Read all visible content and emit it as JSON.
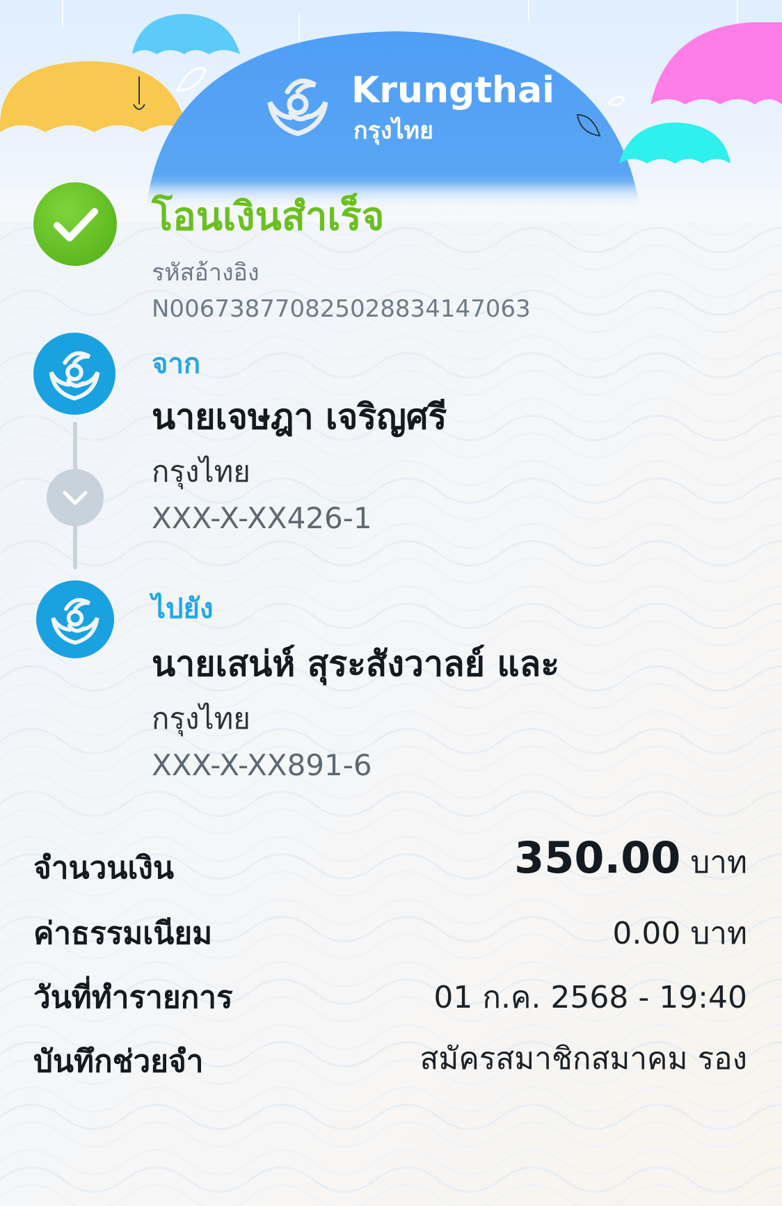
{
  "header": {
    "brand_name": "Krungthai",
    "brand_name_thai": "กรุงไทย"
  },
  "status": {
    "title": "โอนเงินสำเร็จ",
    "reference_label": "รหัสอ้างอิง",
    "reference_value": "N006738770825028834147063"
  },
  "from": {
    "label": "จาก",
    "name": "นายเจษฎา เจริญศรี",
    "bank": "กรุงไทย",
    "account": "XXX-X-XX426-1"
  },
  "to": {
    "label": "ไปยัง",
    "name": "นายเสน่ห์ สุระสังวาลย์ และ",
    "bank": "กรุงไทย",
    "account": "XXX-X-XX891-6"
  },
  "details": {
    "amount_label": "จำนวนเงิน",
    "amount_value": "350.00",
    "amount_unit": "บาท",
    "fee_label": "ค่าธรรมเนียม",
    "fee_value": "0.00 บาท",
    "date_label": "วันที่ทำรายการ",
    "date_value": "01 ก.ค. 2568 - 19:40",
    "memo_label": "บันทึกช่วยจำ",
    "memo_value": "สมัครสมาชิกสมาคม รอง"
  },
  "colors": {
    "success_green": "#6bbf20",
    "label_blue": "#23a6e8",
    "brand_blue": "#4fa3f5",
    "bank_logo_blue": "#1aa1e0"
  },
  "icons": [
    "check-icon",
    "krungthai-logo-icon",
    "chevron-down-icon"
  ]
}
